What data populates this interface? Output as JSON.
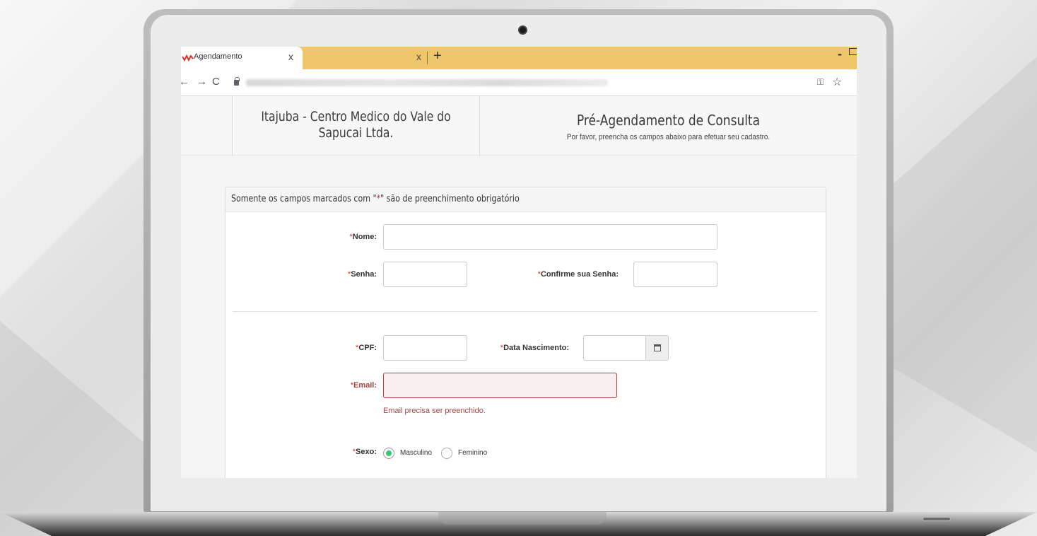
{
  "browser": {
    "tab_title": "Agendamento",
    "tab_close": "x",
    "tab2_close": "x",
    "new_tab": "+",
    "nav_back": "←",
    "nav_forward": "→",
    "nav_reload": "C",
    "window_minimize": "-",
    "key_icon": "⚿",
    "star_icon": "☆",
    "menu_icon": "⋮",
    "accent_color": "#f0c66b"
  },
  "header": {
    "clinic_name": "Itajuba - Centro Medico do Vale do Sapucai Ltda.",
    "title": "Pré-Agendamento de Consulta",
    "subtitle": "Por favor, preencha os campos abaixo para efetuar seu cadastro."
  },
  "form": {
    "notice_prefix": "Somente os campos marcados com \"",
    "notice_mark": "*",
    "notice_suffix": "\" são de preenchimento obrigatório",
    "required_mark": "*",
    "fields": {
      "nome_label": "Nome:",
      "nome_value": "",
      "senha_label": "Senha:",
      "senha_value": "",
      "confirme_label": "Confirme sua Senha:",
      "confirme_value": "",
      "cpf_label": "CPF:",
      "cpf_value": "",
      "nascimento_label": "Data Nascimento:",
      "nascimento_value": "",
      "email_label": "Email:",
      "email_value": "",
      "email_error": "Email precisa ser preenchido.",
      "sexo_label": "Sexo:",
      "sexo_options": [
        "Masculino",
        "Feminino"
      ],
      "sexo_selected": "Masculino"
    },
    "error_color": "#a94442",
    "radio_color": "#2ecc71"
  }
}
